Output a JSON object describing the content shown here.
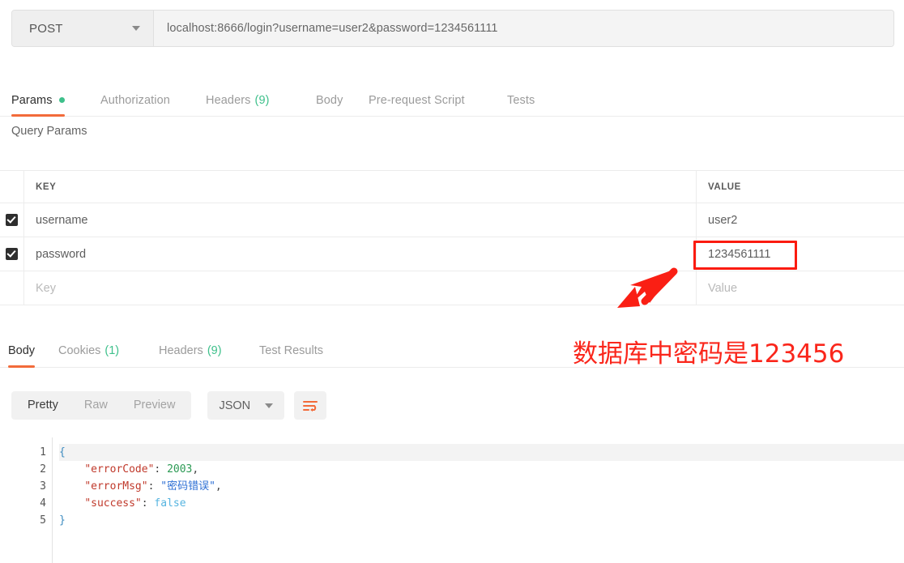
{
  "request_bar": {
    "method": "POST",
    "method_caret": "chevron-down-icon",
    "url": "localhost:8666/login?username=user2&password=1234561111"
  },
  "request_tabs": [
    {
      "label": "Params",
      "badge": "",
      "dot": true,
      "active": true
    },
    {
      "label": "Authorization",
      "badge": "",
      "dot": false,
      "active": false
    },
    {
      "label": "Headers",
      "badge": "(9)",
      "dot": false,
      "active": false
    },
    {
      "label": "Body",
      "badge": "",
      "dot": false,
      "active": false
    },
    {
      "label": "Pre-request Script",
      "badge": "",
      "dot": false,
      "active": false
    },
    {
      "label": "Tests",
      "badge": "",
      "dot": false,
      "active": false
    }
  ],
  "query_params": {
    "section_title": "Query Params",
    "columns": {
      "key": "KEY",
      "value": "VALUE"
    },
    "rows": [
      {
        "checked": true,
        "key": "username",
        "value": "user2",
        "placeholder": false
      },
      {
        "checked": true,
        "key": "password",
        "value": "1234561111",
        "placeholder": false
      },
      {
        "checked": false,
        "key": "Key",
        "value": "Value",
        "placeholder": true
      }
    ]
  },
  "response_tabs": [
    {
      "label": "Body",
      "badge": "",
      "active": true
    },
    {
      "label": "Cookies",
      "badge": "(1)",
      "active": false
    },
    {
      "label": "Headers",
      "badge": "(9)",
      "active": false
    },
    {
      "label": "Test Results",
      "badge": "",
      "active": false
    }
  ],
  "body_toolbar": {
    "modes": [
      {
        "label": "Pretty",
        "active": true
      },
      {
        "label": "Raw",
        "active": false
      },
      {
        "label": "Preview",
        "active": false
      }
    ],
    "format": "JSON",
    "format_caret": "chevron-down-icon",
    "wrap_icon": "word-wrap-icon"
  },
  "response_body": {
    "line_numbers": [
      "1",
      "2",
      "3",
      "4",
      "5"
    ],
    "lines": [
      [
        {
          "t": "{",
          "c": "punct"
        }
      ],
      [
        {
          "t": "    ",
          "c": "plain"
        },
        {
          "t": "\"errorCode\"",
          "c": "key"
        },
        {
          "t": ": ",
          "c": "plain"
        },
        {
          "t": "2003",
          "c": "num"
        },
        {
          "t": ",",
          "c": "plain"
        }
      ],
      [
        {
          "t": "    ",
          "c": "plain"
        },
        {
          "t": "\"errorMsg\"",
          "c": "key"
        },
        {
          "t": ": ",
          "c": "plain"
        },
        {
          "t": "\"密码错误\"",
          "c": "str"
        },
        {
          "t": ",",
          "c": "plain"
        }
      ],
      [
        {
          "t": "    ",
          "c": "plain"
        },
        {
          "t": "\"success\"",
          "c": "key"
        },
        {
          "t": ": ",
          "c": "plain"
        },
        {
          "t": "false",
          "c": "bool"
        }
      ],
      [
        {
          "t": "}",
          "c": "punct"
        }
      ]
    ],
    "raw_text": "{\n    \"errorCode\": 2003,\n    \"errorMsg\": \"密码错误\",\n    \"success\": false\n}"
  },
  "annotations": {
    "note_text": "数据库中密码是123456",
    "note_color": "#fa261b",
    "highlight_box_color": "#fb1b10",
    "highlight_target": "1234561111",
    "arrow": "red-arrow-icon"
  }
}
